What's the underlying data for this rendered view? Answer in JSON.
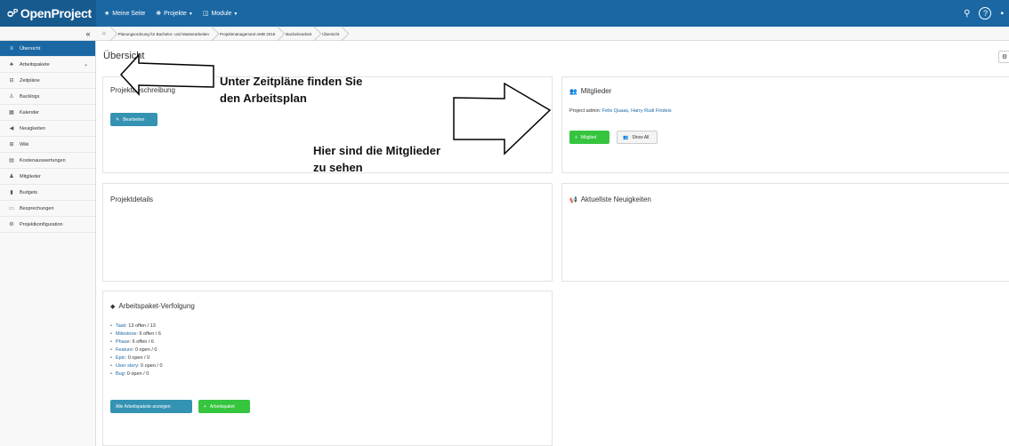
{
  "app": {
    "logo_text": "OpenProject",
    "accent": "#1a67a3"
  },
  "topnav": {
    "items": [
      {
        "icon": "star-icon",
        "label": "Meine Seite"
      },
      {
        "icon": "projects-icon",
        "label": "Projekte",
        "caret": "▾"
      },
      {
        "icon": "modules-icon",
        "label": "Module",
        "caret": "▾"
      }
    ],
    "search_glyph": "⚲",
    "help_glyph": "?"
  },
  "collapse_glyph": "«",
  "breadcrumb": [
    "Planungsordnung für Bachelor- und Masterarbeiten",
    "Projektmanagement AMB 2016",
    "Bachelorarbeit",
    "Übersicht"
  ],
  "sidebar": {
    "items": [
      {
        "label": "Übersicht",
        "icon": "overview-icon",
        "glyph": "≡"
      },
      {
        "label": "Arbeitspakete",
        "icon": "work-packages-icon",
        "glyph": "♣",
        "chevron": "⌄"
      },
      {
        "label": "Zeitpläne",
        "icon": "timelines-icon",
        "glyph": "⊟"
      },
      {
        "label": "Backlogs",
        "icon": "backlogs-icon",
        "glyph": "♙"
      },
      {
        "label": "Kalender",
        "icon": "calendar-icon",
        "glyph": "▦"
      },
      {
        "label": "Neuigkeiten",
        "icon": "news-icon",
        "glyph": "◀"
      },
      {
        "label": "Wiki",
        "icon": "wiki-icon",
        "glyph": "⊞"
      },
      {
        "label": "Kostenauswertungen",
        "icon": "cost-reports-icon",
        "glyph": "▤"
      },
      {
        "label": "Mitglieder",
        "icon": "members-icon",
        "glyph": "♟"
      },
      {
        "label": "Budgets",
        "icon": "budgets-icon",
        "glyph": "▮"
      },
      {
        "label": "Besprechungen",
        "icon": "meetings-icon",
        "glyph": "▭"
      },
      {
        "label": "Projektkonfiguration",
        "icon": "project-settings-icon",
        "glyph": "⚙"
      }
    ]
  },
  "page": {
    "title": "Übersicht",
    "settings_glyph": "⚙"
  },
  "widgets": {
    "description": {
      "title": "Projektbeschreibung",
      "edit_label": "Bearbeiten"
    },
    "members": {
      "title": "Mitglieder",
      "admin_prefix": "Project admin: ",
      "admins": [
        "Felix Quaas",
        "Harry Rudi Findeis"
      ],
      "add_label": "Mitglied",
      "show_all_label": "Show All"
    },
    "details": {
      "title": "Projektdetails"
    },
    "news": {
      "title": "Aktuellste Neuigkeiten"
    },
    "tracking": {
      "title": "Arbeitspaket-Verfolgung",
      "rows": [
        {
          "type": "Task",
          "text": ": 13 offen / 13"
        },
        {
          "type": "Milestone",
          "text": ": 6 offen / 6"
        },
        {
          "type": "Phase",
          "text": ": 6 offen / 6"
        },
        {
          "type": "Feature",
          "text": ": 0 open / 0"
        },
        {
          "type": "Epic",
          "text": ": 0 open / 0"
        },
        {
          "type": "User story",
          "text": ": 0 open / 0"
        },
        {
          "type": "Bug",
          "text": ": 0 open / 0"
        }
      ],
      "show_all_label": "Alle Arbeitspakete anzeigen",
      "add_label": "Arbeitspaket"
    }
  },
  "annotations": {
    "timelines_note_line1": "Unter Zeitpläne finden Sie",
    "timelines_note_line2": "den Arbeitsplan",
    "members_note_line1": "Hier sind die Mitglieder",
    "members_note_line2": "zu sehen"
  }
}
